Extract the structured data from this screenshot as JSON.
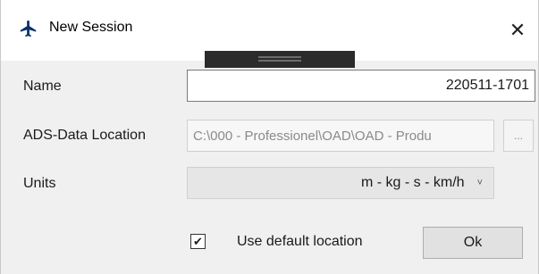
{
  "window": {
    "title": "New Session",
    "app_icon": "airplane-icon",
    "close_glyph": "✕",
    "accent_color": "#0b2f6b"
  },
  "form": {
    "name": {
      "label": "Name",
      "value": "220511-1701"
    },
    "ads_data_location": {
      "label": "ADS-Data Location",
      "value": "C:\\000 - Professionel\\OAD\\OAD - Produ",
      "disabled": true,
      "browse_label": "..."
    },
    "units": {
      "label": "Units",
      "selected": "m - kg - s - km/h",
      "chevron": "˅"
    },
    "use_default_location": {
      "label": "Use default location",
      "checked": true,
      "check_glyph": "✔"
    },
    "ok_label": "Ok"
  }
}
